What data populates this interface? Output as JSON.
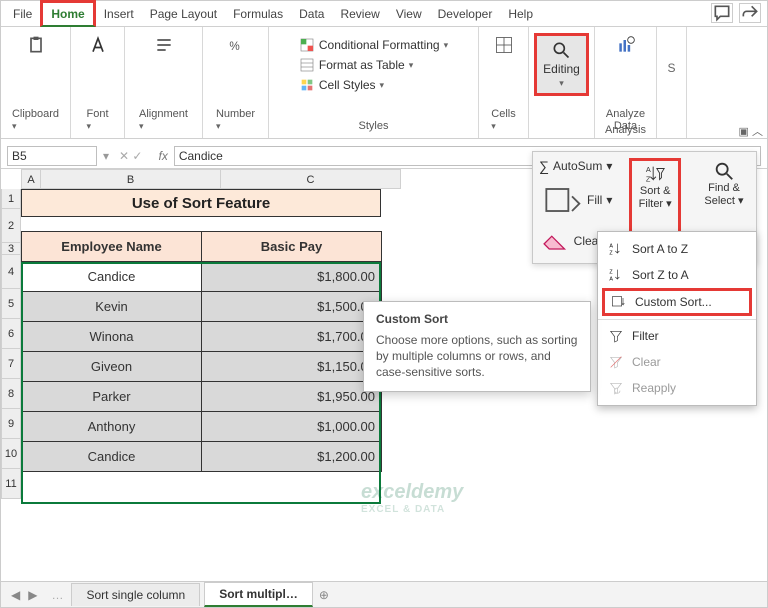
{
  "tabs": {
    "file": "File",
    "home": "Home",
    "insert": "Insert",
    "page": "Page Layout",
    "formulas": "Formulas",
    "data": "Data",
    "review": "Review",
    "view": "View",
    "developer": "Developer",
    "help": "Help"
  },
  "ribbon": {
    "clipboard": "Clipboard",
    "font": "Font",
    "alignment": "Alignment",
    "number": "Number",
    "styles": "Styles",
    "cond": "Conditional Formatting",
    "tablefmt": "Format as Table",
    "cellstyles": "Cell Styles",
    "cells": "Cells",
    "editing": "Editing",
    "analyze1": "Analyze",
    "analyze2": "Data",
    "analysis": "Analysis",
    "s": "S"
  },
  "editing_panel": {
    "autosum": "AutoSum",
    "fill": "Fill",
    "clear": "Clear",
    "sort1": "Sort &",
    "sort2": "Filter",
    "find1": "Find &",
    "find2": "Select"
  },
  "dropdown": {
    "az": "Sort A to Z",
    "za": "Sort Z to A",
    "custom": "Custom Sort...",
    "filter": "Filter",
    "clear": "Clear",
    "reapply": "Reapply"
  },
  "tooltip": {
    "title": "Custom Sort",
    "body": "Choose more options, such as sorting by multiple columns or rows, and case-sensitive sorts."
  },
  "namebox": "B5",
  "fx_sym": "fx",
  "formula_val": "Candice",
  "title": "Use of Sort Feature",
  "headers": {
    "emp": "Employee Name",
    "pay": "Basic Pay"
  },
  "rows": [
    {
      "name": "Candice",
      "pay": "$1,800.00"
    },
    {
      "name": "Kevin",
      "pay": "$1,500.00"
    },
    {
      "name": "Winona",
      "pay": "$1,700.00"
    },
    {
      "name": "Giveon",
      "pay": "$1,150.00"
    },
    {
      "name": "Parker",
      "pay": "$1,950.00"
    },
    {
      "name": "Anthony",
      "pay": "$1,000.00"
    },
    {
      "name": "Candice",
      "pay": "$1,200.00"
    }
  ],
  "sheets": {
    "s1": "Sort single column",
    "s2": "Sort multipl…"
  },
  "cols": [
    "A",
    "B",
    "C"
  ],
  "rownums": [
    "1",
    "2",
    "3",
    "4",
    "5",
    "6",
    "7",
    "8",
    "9",
    "10",
    "11"
  ],
  "watermark": {
    "main": "exceldemy",
    "sub": "EXCEL & DATA"
  },
  "drop_sym": "▾",
  "tri": "◀",
  "tri2": "▶",
  "pipe": "…",
  "plus": "⊕",
  "chart_data": {
    "type": "table",
    "title": "Use of Sort Feature",
    "columns": [
      "Employee Name",
      "Basic Pay"
    ],
    "rows": [
      [
        "Candice",
        1800
      ],
      [
        "Kevin",
        1500
      ],
      [
        "Winona",
        1700
      ],
      [
        "Giveon",
        1150
      ],
      [
        "Parker",
        1950
      ],
      [
        "Anthony",
        1000
      ],
      [
        "Candice",
        1200
      ]
    ],
    "currency": "$",
    "decimals": 2
  }
}
